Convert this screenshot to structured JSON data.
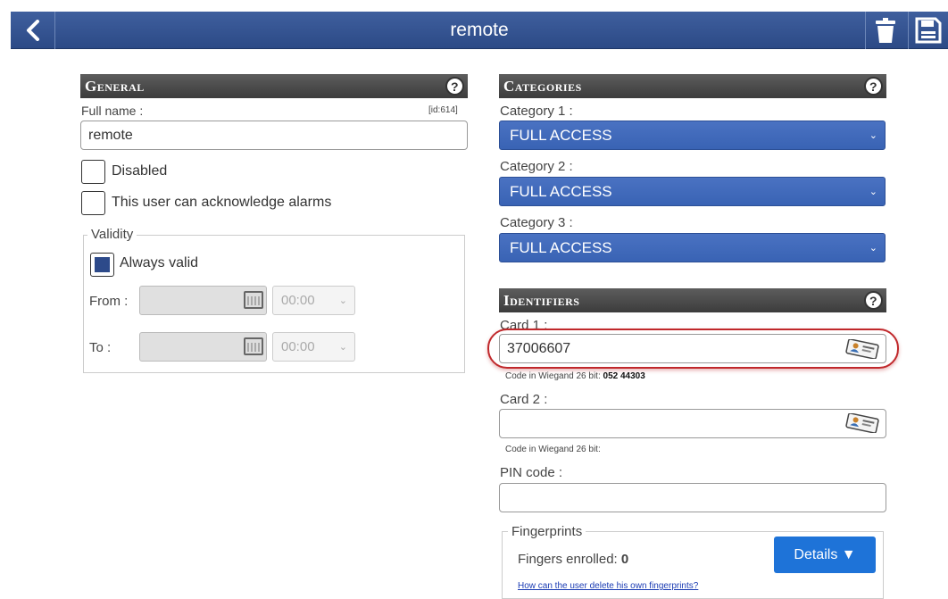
{
  "header": {
    "title": "remote",
    "back_icon": "chevron-left-icon",
    "delete_icon": "trash-icon",
    "save_icon": "save-icon"
  },
  "general": {
    "heading": "General",
    "help": "?",
    "full_name_label": "Full name :",
    "id_text": "[id:614]",
    "full_name_value": "remote",
    "disabled_label": "Disabled",
    "disabled_checked": false,
    "ack_label": "This user can acknowledge alarms",
    "ack_checked": false,
    "validity": {
      "legend": "Validity",
      "always_valid_label": "Always valid",
      "always_valid_checked": true,
      "from_label": "From :",
      "to_label": "To :",
      "from_time": "00:00",
      "to_time": "00:00"
    }
  },
  "categories": {
    "heading": "Categories",
    "help": "?",
    "items": [
      {
        "label": "Category 1 :",
        "value": "FULL ACCESS"
      },
      {
        "label": "Category 2 :",
        "value": "FULL ACCESS"
      },
      {
        "label": "Category 3 :",
        "value": "FULL ACCESS"
      }
    ]
  },
  "identifiers": {
    "heading": "Identifiers",
    "help": "?",
    "card1_label": "Card 1 :",
    "card1_value": "37006607",
    "card1_wiegand_label": "Code in Wiegand 26 bit:",
    "card1_wiegand_value": "052 44303",
    "card2_label": "Card 2 :",
    "card2_value": "",
    "card2_wiegand_label": "Code in Wiegand 26 bit:",
    "pin_label": "PIN code :",
    "pin_value": "",
    "card_icon": "id-card-icon"
  },
  "fingerprints": {
    "legend": "Fingerprints",
    "enrolled_label": "Fingers enrolled:",
    "enrolled_count": "0",
    "details_label": "Details ▼",
    "help_link": "How can the user delete his own fingerprints?"
  },
  "colors": {
    "header_bg": "#2f4d8a",
    "select_bg": "#3f68b8",
    "section_bg": "#4a4a4a",
    "details_button": "#1e73d8",
    "highlight": "#c0282b"
  }
}
